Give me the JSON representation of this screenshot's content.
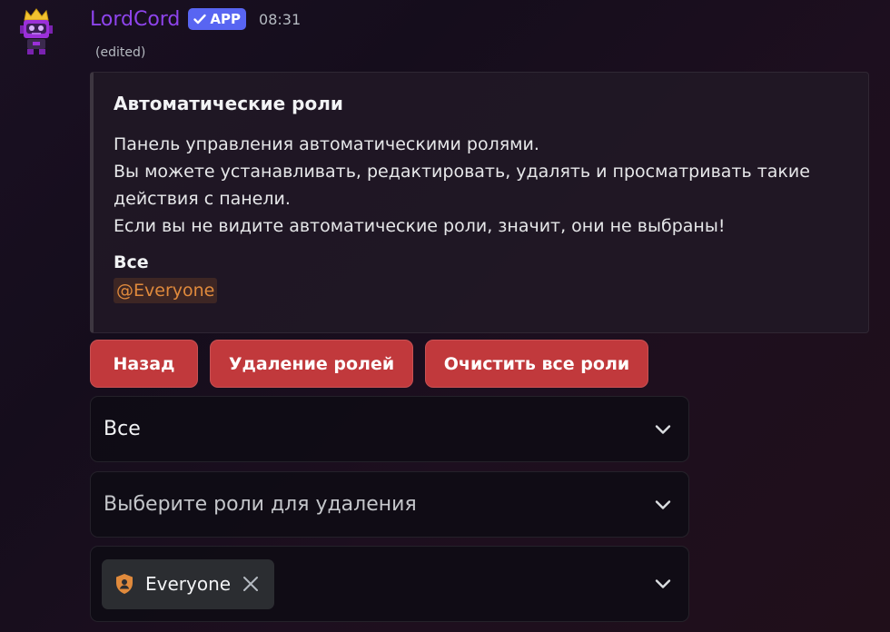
{
  "message": {
    "username": "LordCord",
    "badge": "APP",
    "time": "08:31",
    "edited": "(edited)"
  },
  "embed": {
    "title": "Автоматические роли",
    "description_lines": [
      "Панель управления автоматическими ролями.",
      "Вы можете устанавливать, редактировать, удалять и просматривать такие",
      "действия с панели.",
      "Если вы не видите автоматические роли, значит, они не выбраны!"
    ],
    "field_name": "Все",
    "field_value": "@Everyone"
  },
  "buttons": {
    "back": "Назад",
    "delete_roles": "Удаление ролей",
    "clear_all": "Очистить все роли"
  },
  "selects": {
    "category_value": "Все",
    "remove_placeholder": "Выберите роли для удаления",
    "chip_label": "Everyone"
  },
  "colors": {
    "username": "#8e44ec",
    "badge": "#5865f2",
    "danger_button": "#c1393c",
    "mention": "#e08a3c"
  }
}
